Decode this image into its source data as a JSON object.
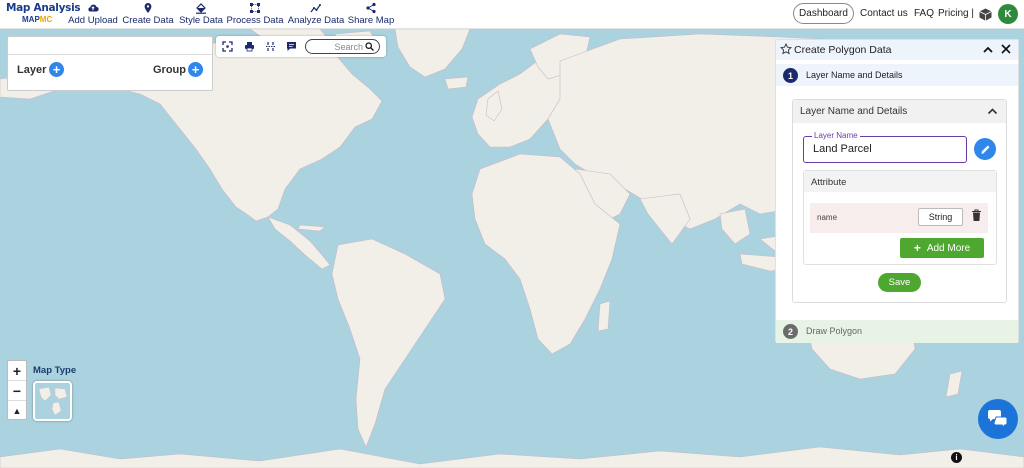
{
  "app": {
    "logo_line1": "Map Analysis",
    "logo_line2_a": "MAP",
    "logo_line2_b": "MC"
  },
  "nav": {
    "items": [
      {
        "label": "Add Upload",
        "icon": "cloud-upload-icon"
      },
      {
        "label": "Create Data",
        "icon": "map-pin-icon"
      },
      {
        "label": "Style Data",
        "icon": "paint-bucket-icon"
      },
      {
        "label": "Process Data",
        "icon": "process-nodes-icon"
      },
      {
        "label": "Analyze Data",
        "icon": "analyze-chart-icon"
      },
      {
        "label": "Share Map",
        "icon": "share-icon"
      }
    ],
    "dashboard": "Dashboard",
    "contact": "Contact us",
    "faq": "FAQ",
    "pricing": "Pricing |",
    "avatar_initial": "K",
    "brand_color": "#1a2a6c",
    "avatar_color": "#2e8b3e"
  },
  "layer_panel": {
    "layer_label": "Layer",
    "group_label": "Group"
  },
  "toolbar": {
    "search_placeholder": "Search",
    "icons": [
      "fullscreen-icon",
      "print-icon",
      "measure-icon",
      "comment-icon",
      "search-icon"
    ]
  },
  "map_controls": {
    "zoom_in": "+",
    "zoom_out": "−",
    "reset_north": "▲",
    "map_type_label": "Map Type"
  },
  "create_panel": {
    "title": "Create Polygon Data",
    "step1": {
      "number": "1",
      "label": "Layer Name and Details"
    },
    "section_title": "Layer Name and Details",
    "layer_name_label": "Layer Name",
    "layer_name_value": "Land Parcel",
    "attribute_title": "Attribute",
    "attribute": {
      "name": "name",
      "type": "String"
    },
    "add_more": "Add More",
    "save": "Save",
    "step2": {
      "number": "2",
      "label": "Draw Polygon"
    },
    "accent_color": "#6a3ea8",
    "green": "#4ea72e"
  },
  "misc": {
    "info": "i"
  }
}
